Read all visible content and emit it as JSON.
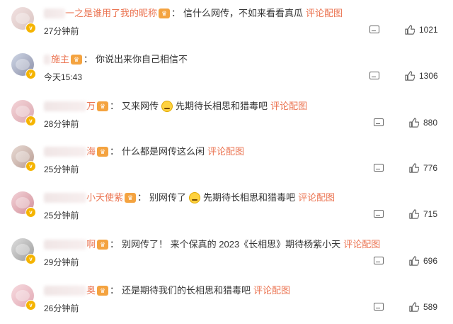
{
  "comments": [
    {
      "username_visible": "一之是谁用了我的昵称",
      "colon": "：",
      "text": "信什么网传，不如来看看真瓜",
      "has_emoji": false,
      "text2": "",
      "link": "评论配图",
      "time": "27分钟前",
      "likes": "1021"
    },
    {
      "username_visible": "施主",
      "colon": "：",
      "text": "你说出来你自己相信不",
      "has_emoji": false,
      "text2": "",
      "link": "",
      "time": "今天15:43",
      "likes": "1306"
    },
    {
      "username_visible": "万",
      "colon": "：",
      "text": "又来网传",
      "has_emoji": true,
      "text2": "先期待长相思和猎毒吧",
      "link": "评论配图",
      "time": "28分钟前",
      "likes": "880"
    },
    {
      "username_visible": "海",
      "colon": "：",
      "text": "什么都是网传这么闲",
      "has_emoji": false,
      "text2": "",
      "link": "评论配图",
      "time": "25分钟前",
      "likes": "776"
    },
    {
      "username_visible": "小天使紫",
      "colon": "：",
      "text": "别网传了",
      "has_emoji": true,
      "text2": "先期待长相思和猎毒吧",
      "link": "评论配图",
      "time": "25分钟前",
      "likes": "715"
    },
    {
      "username_visible": "啊",
      "colon": "：",
      "text": "别网传了！ 来个保真的 2023《长相思》期待杨紫小天",
      "has_emoji": false,
      "text2": "",
      "link": "评论配图",
      "time": "29分钟前",
      "likes": "696"
    },
    {
      "username_visible": "奥",
      "colon": "：",
      "text": "还是期待我们的长相思和猎毒吧",
      "has_emoji": false,
      "text2": "",
      "link": "评论配图",
      "time": "26分钟前",
      "likes": "589"
    }
  ],
  "icons": {
    "reply": "comment-reply-icon",
    "like": "thumbs-up-icon",
    "vip": "crown-badge-icon",
    "verified": "v-badge-icon",
    "emoji": "smile-emoji-icon"
  },
  "colors": {
    "username": "#eb7350",
    "link": "#eb7350",
    "text": "#333333",
    "badge": "#f5b400"
  }
}
